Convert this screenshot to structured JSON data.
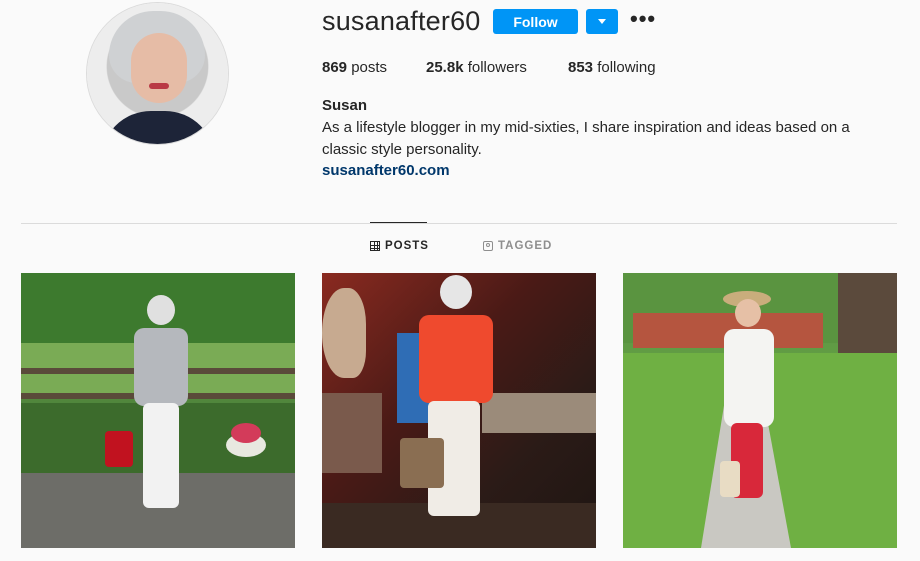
{
  "profile": {
    "username": "susanafter60",
    "follow_label": "Follow",
    "more_icon": "•••",
    "full_name": "Susan",
    "bio": "As a lifestyle blogger in my mid-sixties, I share inspiration and ideas based on a classic style personality.",
    "website": "susanafter60.com"
  },
  "stats": {
    "posts_count": "869",
    "posts_label": "posts",
    "followers_count": "25.8k",
    "followers_label": "followers",
    "following_count": "853",
    "following_label": "following"
  },
  "tabs": [
    {
      "label": "POSTS",
      "icon": "grid-icon",
      "active": true
    },
    {
      "label": "TAGGED",
      "icon": "tag-icon",
      "active": false
    }
  ],
  "colors": {
    "accent": "#0095f6",
    "link": "#00376b",
    "text": "#262626",
    "muted": "#8e8e8e",
    "background": "#fafafa"
  }
}
